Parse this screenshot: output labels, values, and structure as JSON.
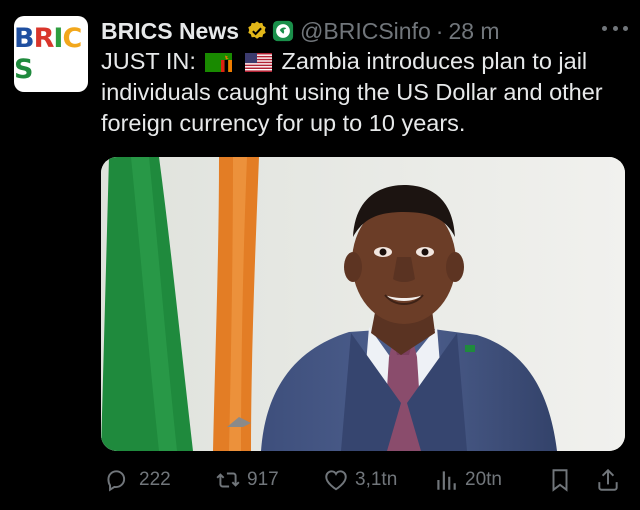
{
  "tweet": {
    "author_name": "BRICS News",
    "author_handle": "@BRICSinfo",
    "separator": "·",
    "time": "28 m",
    "avatar_text": "BRICS",
    "text_prefix": "JUST IN:",
    "text_body": "Zambia introduces plan to jail individuals caught using the US Dollar and other foreign currency for up to 10 years.",
    "flags": [
      "zambia-flag",
      "us-flag"
    ]
  },
  "actions": {
    "replies": "222",
    "reposts": "917",
    "likes": "3,1tn",
    "views": "20tn"
  },
  "icons": [
    "verified-badge-icon",
    "affiliate-badge-icon",
    "more-icon",
    "reply-icon",
    "repost-icon",
    "like-icon",
    "views-icon",
    "bookmark-icon",
    "share-icon"
  ],
  "colors": {
    "background": "#000000",
    "primary_text": "#e7e9ea",
    "secondary_text": "#71767b",
    "verified_gold": "#e2b719"
  }
}
